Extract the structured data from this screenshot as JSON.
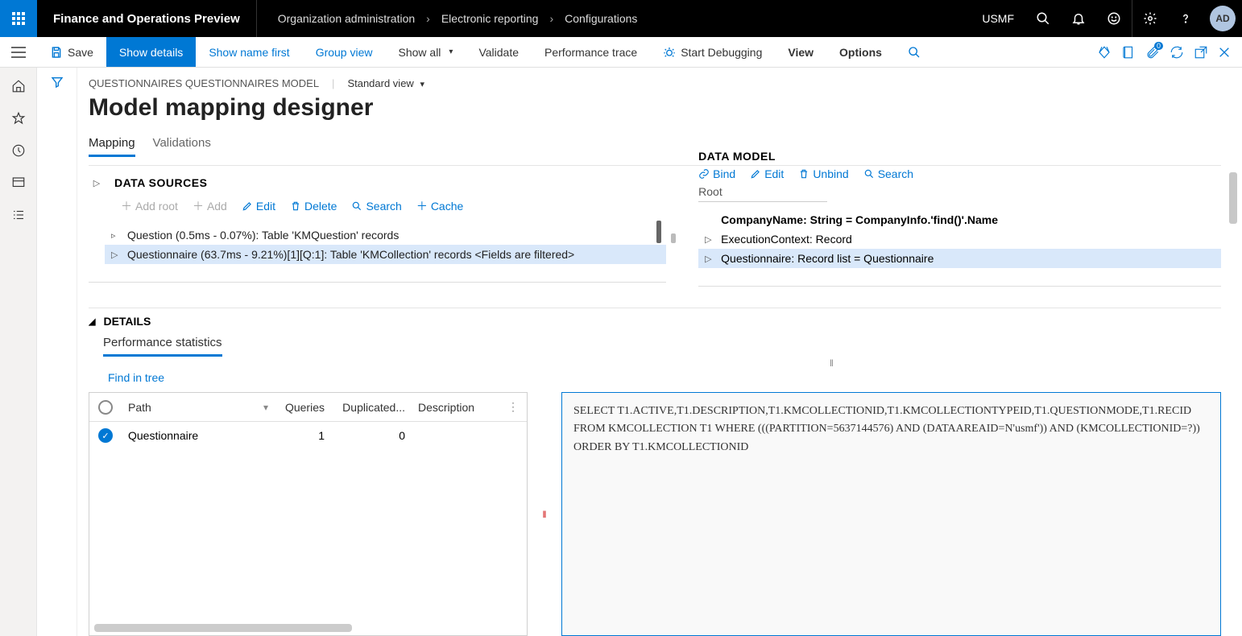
{
  "header": {
    "app_title": "Finance and Operations Preview",
    "breadcrumbs": [
      "Organization administration",
      "Electronic reporting",
      "Configurations"
    ],
    "company": "USMF",
    "avatar": "AD"
  },
  "toolbar": {
    "save": "Save",
    "show_details": "Show details",
    "show_name_first": "Show name first",
    "group_view": "Group view",
    "show_all": "Show all",
    "validate": "Validate",
    "perf_trace": "Performance trace",
    "start_debug": "Start Debugging",
    "view": "View",
    "options": "Options"
  },
  "page": {
    "context": "QUESTIONNAIRES QUESTIONNAIRES MODEL",
    "view_name": "Standard view",
    "title": "Model mapping designer"
  },
  "main_tabs": {
    "mapping": "Mapping",
    "validations": "Validations"
  },
  "datasources": {
    "title": "DATA SOURCES",
    "actions": {
      "add_root": "Add root",
      "add": "Add",
      "edit": "Edit",
      "delete": "Delete",
      "search": "Search",
      "cache": "Cache"
    },
    "rows": [
      "Question (0.5ms - 0.07%): Table 'KMQuestion' records",
      "Questionnaire (63.7ms - 9.21%)[1][Q:1]: Table 'KMCollection' records <Fields are filtered>"
    ]
  },
  "datamodel": {
    "title": "DATA MODEL",
    "actions": {
      "bind": "Bind",
      "edit": "Edit",
      "unbind": "Unbind",
      "search": "Search"
    },
    "root": "Root",
    "rows": [
      "CompanyName: String = CompanyInfo.'find()'.Name",
      "ExecutionContext: Record",
      "Questionnaire: Record list = Questionnaire"
    ]
  },
  "details": {
    "title": "DETAILS",
    "subtab": "Performance statistics",
    "find_in_tree": "Find in tree",
    "columns": {
      "path": "Path",
      "queries": "Queries",
      "duplicated": "Duplicated...",
      "description": "Description"
    },
    "row": {
      "path": "Questionnaire",
      "queries": "1",
      "duplicated": "0"
    },
    "sql": "SELECT T1.ACTIVE,T1.DESCRIPTION,T1.KMCOLLECTIONID,T1.KMCOLLECTIONTYPEID,T1.QUESTIONMODE,T1.RECID FROM KMCOLLECTION T1 WHERE (((PARTITION=5637144576) AND (DATAAREAID=N'usmf')) AND (KMCOLLECTIONID=?)) ORDER BY T1.KMCOLLECTIONID"
  }
}
